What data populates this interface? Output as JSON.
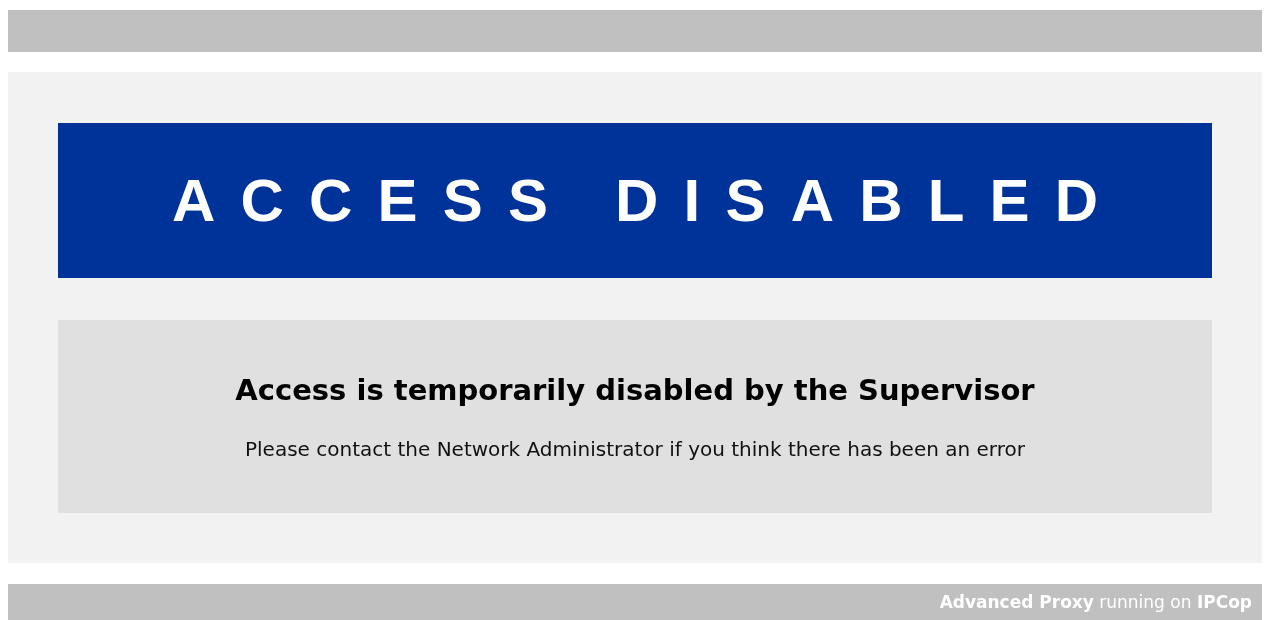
{
  "banner": {
    "title": "ACCESS DISABLED"
  },
  "message": {
    "heading": "Access is temporarily disabled by the Supervisor",
    "text": "Please contact the Network Administrator if you think there has been an error"
  },
  "footer": {
    "text": "**Advanced Proxy** running on **IPCop**"
  }
}
